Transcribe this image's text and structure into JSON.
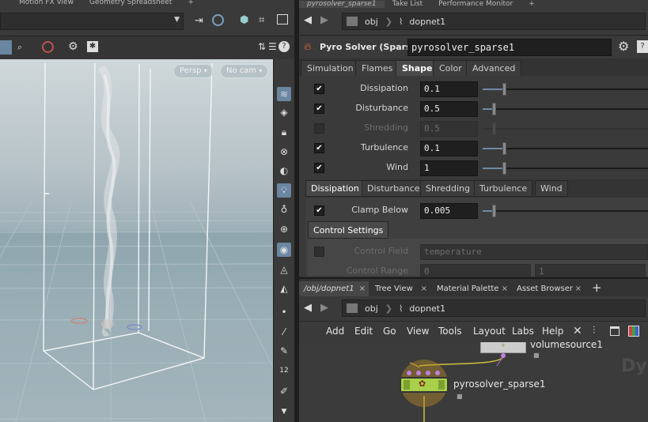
{
  "left_tabs": [
    "Motion FX View",
    "Geometry Spreadsheet"
  ],
  "right_top_tabs": [
    "pyrosolver_sparse1",
    "Take List",
    "Performance Monitor"
  ],
  "viewport": {
    "persp_label": "Persp",
    "cam_label": "No cam"
  },
  "param_path": {
    "root": "obj",
    "node": "dopnet1"
  },
  "node": {
    "type_label": "Pyro Solver (Sparse)",
    "name": "pyrosolver_sparse1"
  },
  "param_tabs": [
    "Simulation",
    "Flames",
    "Shape",
    "Color",
    "Advanced"
  ],
  "active_param_tab": "Shape",
  "params": [
    {
      "label": "Dissipation",
      "value": "0.1",
      "checked": true,
      "enabled": true,
      "fraction": 0.13
    },
    {
      "label": "Disturbance",
      "value": "0.5",
      "checked": true,
      "enabled": true,
      "fraction": 0.07
    },
    {
      "label": "Shredding",
      "value": "0.5",
      "checked": false,
      "enabled": false,
      "fraction": 0.07
    },
    {
      "label": "Turbulence",
      "value": "0.1",
      "checked": true,
      "enabled": true,
      "fraction": 0.13
    },
    {
      "label": "Wind",
      "value": "1",
      "checked": true,
      "enabled": true,
      "fraction": 0.13
    }
  ],
  "sub_tabs": [
    "Dissipation",
    "Disturbance",
    "Shredding",
    "Turbulence",
    "Wind"
  ],
  "active_sub_tab": "Dissipation",
  "clamp": {
    "label": "Clamp Below",
    "value": "0.005",
    "checked": true,
    "fraction": 0.07
  },
  "control_settings_label": "Control Settings",
  "control_field": {
    "label": "Control Field",
    "value": "temperature"
  },
  "control_range": {
    "label": "Control Range",
    "value_a": "0",
    "value_b": "1"
  },
  "network_tabs": [
    "/obj/dopnet1",
    "Tree View",
    "Material Palette",
    "Asset Browser"
  ],
  "network_path": {
    "root": "obj",
    "node": "dopnet1"
  },
  "network_menu": [
    "Add",
    "Edit",
    "Go",
    "View",
    "Tools",
    "Layout",
    "Labs",
    "Help"
  ],
  "network_nodes": {
    "volumesource": "volumesource1",
    "pyrosolver": "pyrosolver_sparse1",
    "watermark": "Dy"
  },
  "colors": {
    "accent": "#6f8aa5",
    "node_green": "#a8d04a",
    "node_ring": "#b58a2a"
  }
}
